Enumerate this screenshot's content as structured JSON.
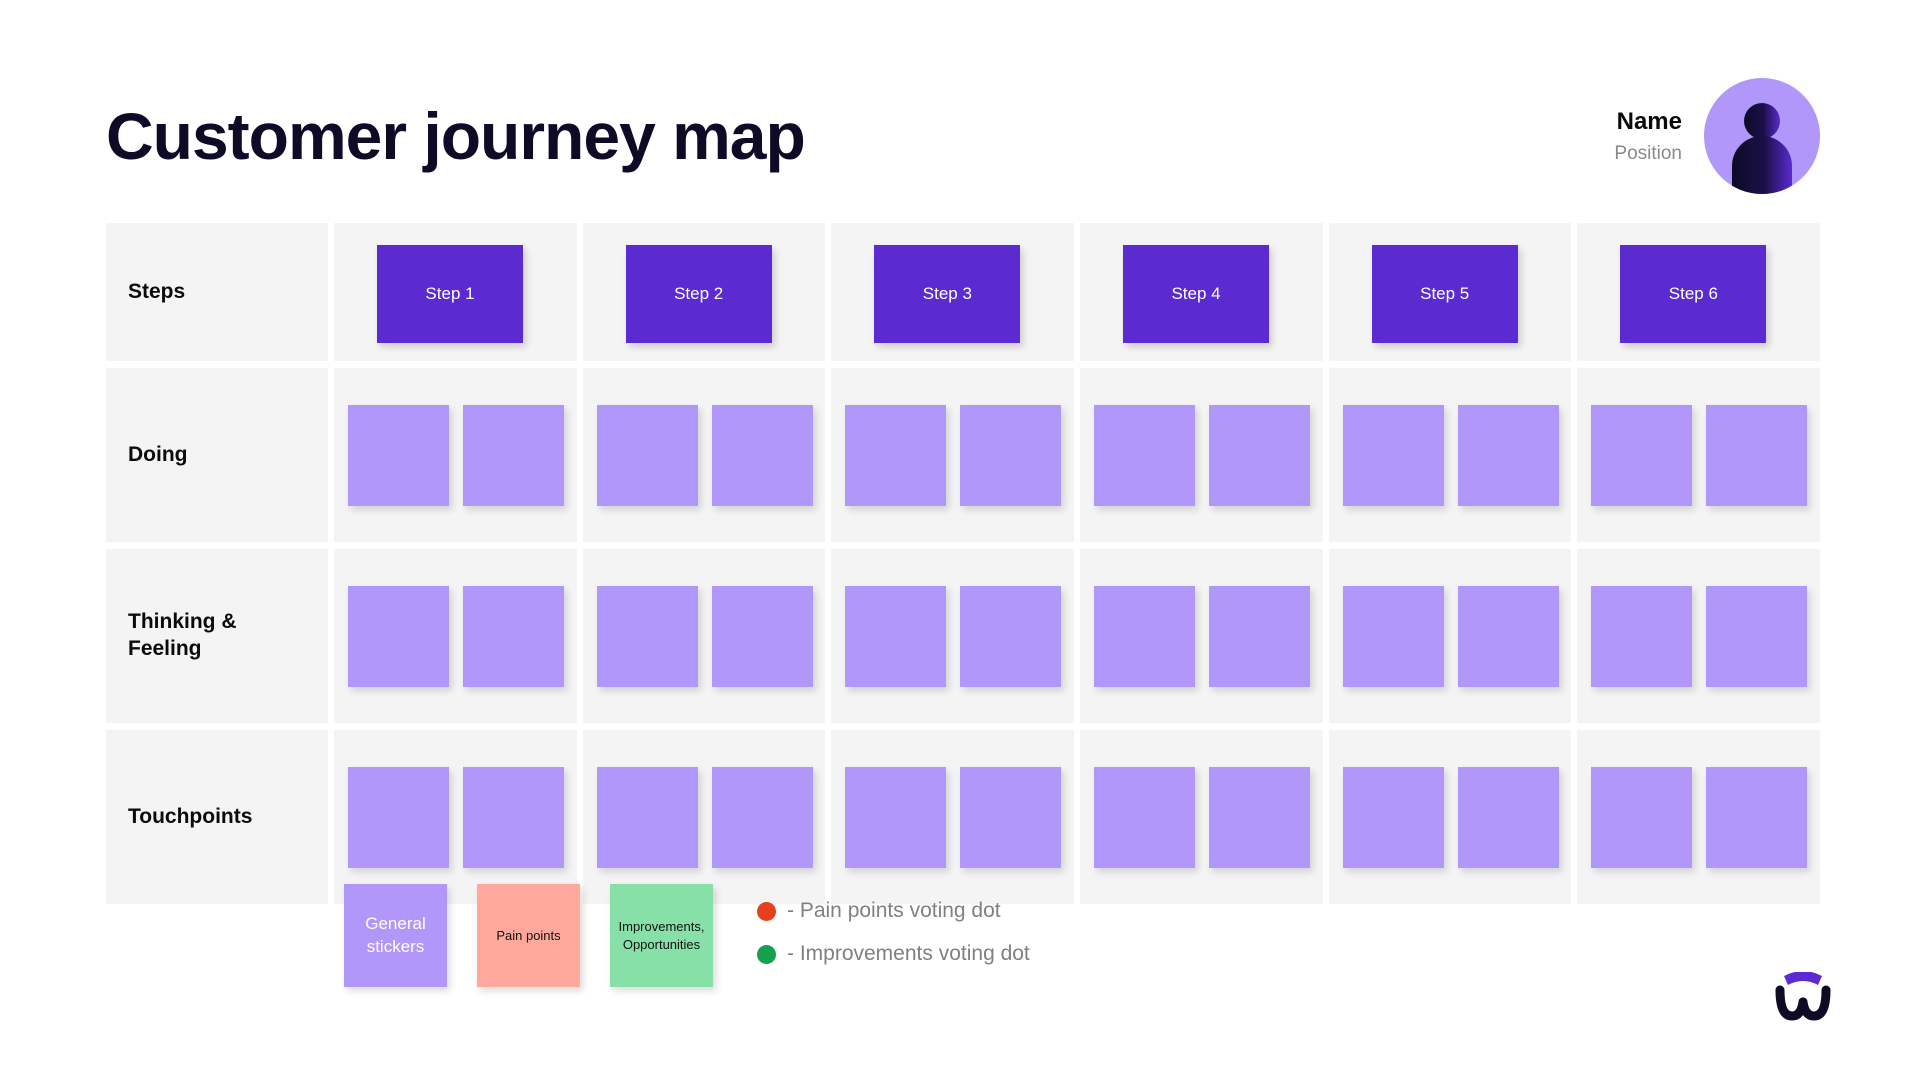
{
  "header": {
    "title": "Customer journey map",
    "persona": {
      "name": "Name",
      "position": "Position",
      "avatar_icon": "user-avatar-icon"
    }
  },
  "colors": {
    "title": "#0d0b26",
    "step_card": "#5b2bd1",
    "sticky_note": "#b197fa",
    "cell_background": "#f4f4f4",
    "pain_points": "#ffa89b",
    "improvements": "#87e0a7",
    "pain_dot": "#e8401c",
    "improvements_dot": "#14a14b",
    "legend_text": "#808080"
  },
  "grid": {
    "steps_row": {
      "label": "Steps",
      "steps": [
        {
          "label": "Step 1"
        },
        {
          "label": "Step 2"
        },
        {
          "label": "Step 3"
        },
        {
          "label": "Step 4"
        },
        {
          "label": "Step 5"
        },
        {
          "label": "Step 6"
        }
      ]
    },
    "note_rows": [
      {
        "label": "Doing",
        "columns": [
          {
            "notes": [
              "",
              ""
            ]
          },
          {
            "notes": [
              "",
              ""
            ]
          },
          {
            "notes": [
              "",
              ""
            ]
          },
          {
            "notes": [
              "",
              ""
            ]
          },
          {
            "notes": [
              "",
              ""
            ]
          },
          {
            "notes": [
              "",
              ""
            ]
          }
        ]
      },
      {
        "label": "Thinking &\nFeeling",
        "columns": [
          {
            "notes": [
              "",
              ""
            ]
          },
          {
            "notes": [
              "",
              ""
            ]
          },
          {
            "notes": [
              "",
              ""
            ]
          },
          {
            "notes": [
              "",
              ""
            ]
          },
          {
            "notes": [
              "",
              ""
            ]
          },
          {
            "notes": [
              "",
              ""
            ]
          }
        ]
      },
      {
        "label": "Touchpoints",
        "columns": [
          {
            "notes": [
              "",
              ""
            ]
          },
          {
            "notes": [
              "",
              ""
            ]
          },
          {
            "notes": [
              "",
              ""
            ]
          },
          {
            "notes": [
              "",
              ""
            ]
          },
          {
            "notes": [
              "",
              ""
            ]
          },
          {
            "notes": [
              "",
              ""
            ]
          }
        ]
      }
    ]
  },
  "legend": {
    "stickers": [
      {
        "label": "General\nstickers",
        "type": "general"
      },
      {
        "label": "Pain points",
        "type": "pain"
      },
      {
        "label": "Improvements,\nOpportunities",
        "type": "improve"
      }
    ],
    "dots": [
      {
        "label": "- Pain points voting dot",
        "color": "red"
      },
      {
        "label": "- Improvements voting dot",
        "color": "green"
      }
    ]
  },
  "logo": {
    "name": "brand-logo-icon"
  }
}
